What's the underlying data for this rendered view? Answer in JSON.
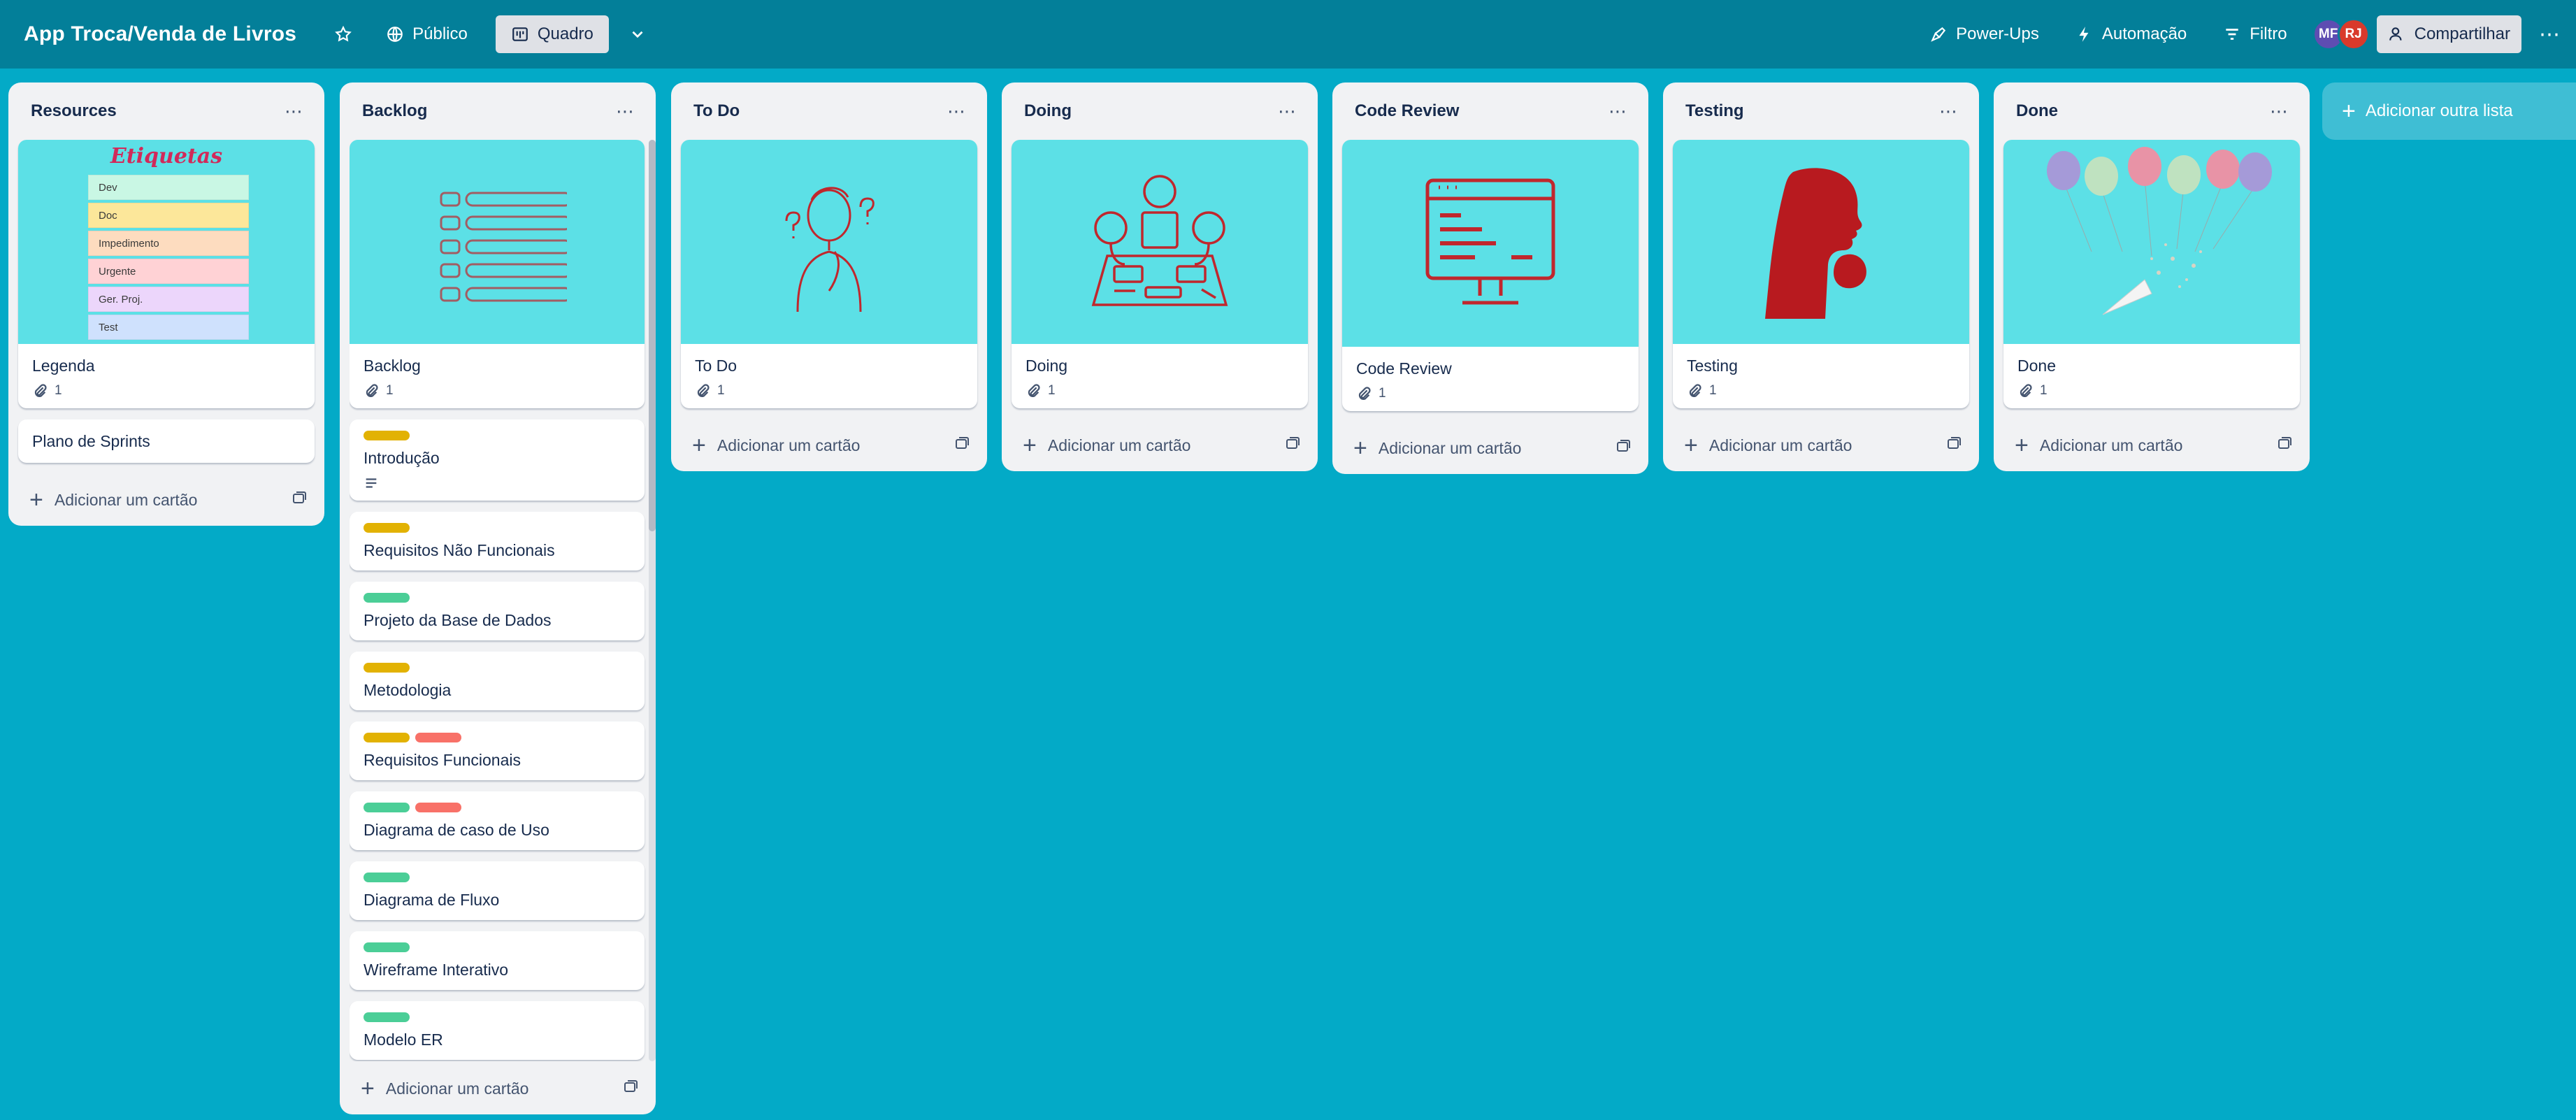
{
  "header": {
    "board_title": "App Troca/Venda de Livros",
    "visibility_label": "Público",
    "view_label": "Quadro",
    "powerups_label": "Power-Ups",
    "automation_label": "Automação",
    "filter_label": "Filtro",
    "share_label": "Compartilhar",
    "members": [
      "MF",
      "RJ"
    ]
  },
  "labels_legend": {
    "title": "Etiquetas",
    "items": [
      "Dev",
      "Doc",
      "Impedimento",
      "Urgente",
      "Ger. Proj.",
      "Test"
    ],
    "colors": [
      "#c9f7e4",
      "#fce79a",
      "#fddcbf",
      "#ffd2d5",
      "#ecd6fb",
      "#cfe1fd"
    ]
  },
  "add_card_label": "Adicionar um cartão",
  "add_list_label": "Adicionar outra lista",
  "lists": [
    {
      "title": "Resources",
      "cards": [
        {
          "title": "Legenda",
          "attachments": "1",
          "cover": "etiquetas"
        },
        {
          "title": "Plano de Sprints"
        }
      ]
    },
    {
      "title": "Backlog",
      "cards": [
        {
          "title": "Backlog",
          "attachments": "1",
          "cover": "backlog-icon"
        },
        {
          "title": "Introdução",
          "labels": [
            "yellow"
          ],
          "has_description": true
        },
        {
          "title": "Requisitos Não Funcionais",
          "labels": [
            "yellow"
          ]
        },
        {
          "title": "Projeto da Base de Dados",
          "labels": [
            "green"
          ]
        },
        {
          "title": "Metodologia",
          "labels": [
            "yellow"
          ]
        },
        {
          "title": "Requisitos Funcionais",
          "labels": [
            "yellow",
            "red"
          ]
        },
        {
          "title": "Diagrama de caso de Uso",
          "labels": [
            "green",
            "red"
          ]
        },
        {
          "title": "Diagrama de Fluxo",
          "labels": [
            "green"
          ]
        },
        {
          "title": "Wireframe Interativo",
          "labels": [
            "green"
          ]
        },
        {
          "title": "Modelo ER",
          "labels": [
            "green"
          ]
        },
        {
          "title": "",
          "labels": [
            "green"
          ]
        }
      ]
    },
    {
      "title": "To Do",
      "cards": [
        {
          "title": "To Do",
          "attachments": "1",
          "cover": "thinking-person"
        }
      ]
    },
    {
      "title": "Doing",
      "cards": [
        {
          "title": "Doing",
          "attachments": "1",
          "cover": "team-working"
        }
      ]
    },
    {
      "title": "Code Review",
      "cards": [
        {
          "title": "Code Review",
          "attachments": "1",
          "cover": "code-monitor"
        }
      ]
    },
    {
      "title": "Testing",
      "cards": [
        {
          "title": "Testing",
          "attachments": "1",
          "cover": "thinking-silhouette"
        }
      ]
    },
    {
      "title": "Done",
      "cards": [
        {
          "title": "Done",
          "attachments": "1",
          "cover": "balloons-confetti"
        }
      ]
    }
  ],
  "colors": {
    "board_bg": "#03aac7",
    "header_bg": "#037f99",
    "cover_bg": "#5ce0e6",
    "illustration_red": "#c0272d"
  }
}
